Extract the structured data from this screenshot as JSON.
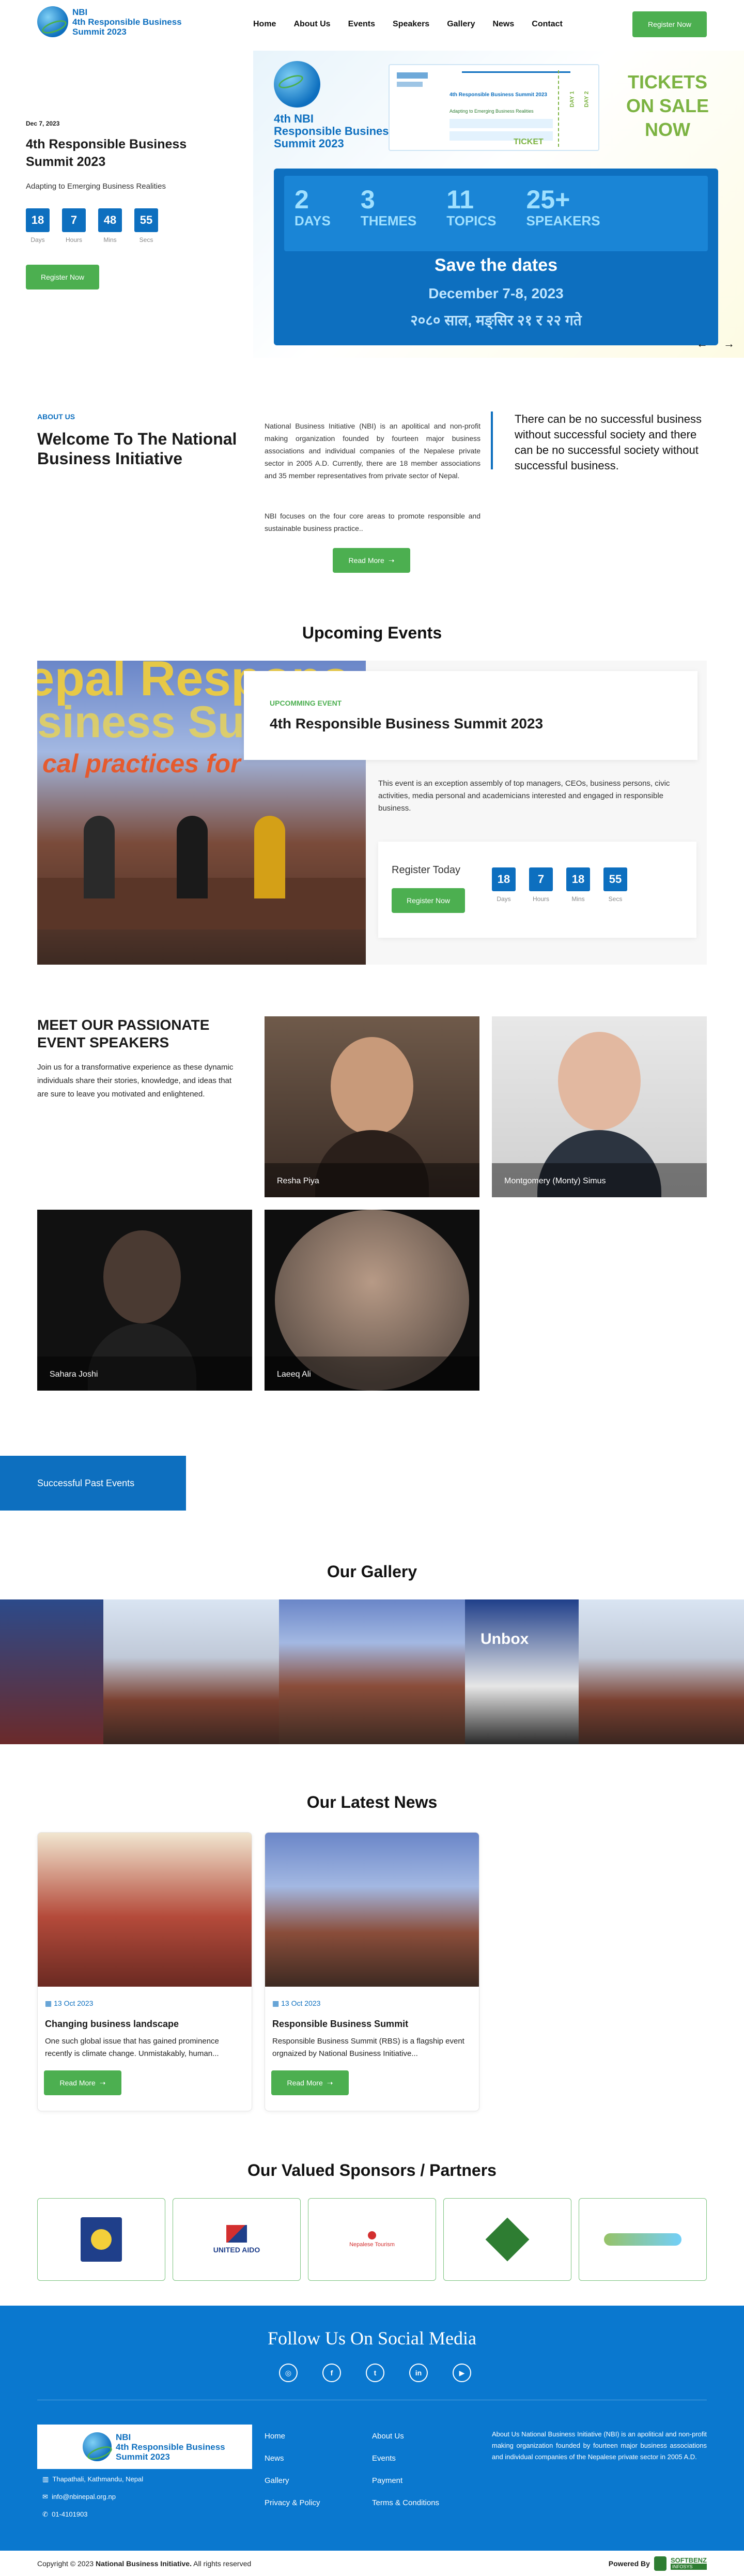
{
  "header": {
    "logo_line1": "NBI",
    "logo_line2": "4th Responsible Business",
    "logo_line3": "Summit 2023",
    "nav": [
      "Home",
      "About Us",
      "Events",
      "Speakers",
      "Gallery",
      "News",
      "Contact"
    ],
    "register_label": "Register Now"
  },
  "hero": {
    "date": "Dec 7, 2023",
    "title": "4th Responsible Business Summit 2023",
    "subtitle": "Adapting to Emerging Business Realities",
    "countdown": [
      {
        "value": "18",
        "label": "Days"
      },
      {
        "value": "7",
        "label": "Hours"
      },
      {
        "value": "48",
        "label": "Mins"
      },
      {
        "value": "55",
        "label": "Secs"
      }
    ],
    "register_label": "Register Now",
    "banner": {
      "logo_line1": "4th NBI",
      "logo_line2": "Responsible Business",
      "logo_line3": "Summit 2023",
      "ticket_title": "4th Responsible Business Summit 2023",
      "ticket_sub": "Adapting to Emerging Business Realities",
      "ticket_word": "TICKET",
      "day1": "DAY 1",
      "day2": "DAY 2",
      "tickets_line1": "TICKETS",
      "tickets_line2": "ON SALE",
      "tickets_line3": "NOW",
      "stats": [
        {
          "num": "2",
          "label": "DAYS"
        },
        {
          "num": "3",
          "label": "THEMES"
        },
        {
          "num": "11",
          "label": "TOPICS"
        },
        {
          "num": "25+",
          "label": "SPEAKERS"
        }
      ],
      "save": "Save the dates",
      "dates": "December 7-8, 2023",
      "dates_np": "२०८० साल, मङ्सिर २१ र २२ गते"
    },
    "prev": "←",
    "next": "→"
  },
  "about": {
    "eyebrow": "ABOUT US",
    "title": "Welcome To The National Business Initiative",
    "p1": "National Business Initiative (NBI) is an apolitical and non-profit making organization founded by fourteen major business associations and individual companies of the Nepalese private sector in 2005 A.D. Currently, there are 18 member associations and 35 member representatives from private sector of Nepal.",
    "p2": "NBI focuses on the four core areas to promote responsible and sustainable business practice..",
    "read_more": "Read More",
    "quote": "There can be no successful business without successful society and there can be no successful society without successful business."
  },
  "upcoming": {
    "section_title": "Upcoming Events",
    "eyebrow": "UPCOMMING EVENT",
    "title": "4th Responsible Business Summit 2023",
    "desc": "This event is an exception assembly of top managers, CEOs, business persons, civic activities, media personal and academicians interested and engaged in responsible business.",
    "register_today": "Register Today",
    "register_label": "Register Now",
    "countdown": [
      {
        "value": "18",
        "label": "Days"
      },
      {
        "value": "7",
        "label": "Hours"
      },
      {
        "value": "18",
        "label": "Mins"
      },
      {
        "value": "55",
        "label": "Secs"
      }
    ],
    "banner_text1": "epal Respons",
    "banner_text2": "siness Sum",
    "banner_text3": "cal practices for"
  },
  "speakers": {
    "title": "MEET OUR PASSIONATE EVENT SPEAKERS",
    "desc": "Join us for a transformative experience as these dynamic individuals share their stories, knowledge, and ideas that are sure to leave you motivated and enlightened.",
    "list": [
      "Resha Piya",
      "Montgomery (Monty) Simus",
      "Sahara Joshi",
      "Laeeq Ali"
    ]
  },
  "past_events": {
    "label": "Successful Past Events"
  },
  "gallery": {
    "title": "Our Gallery",
    "slide_text": "Unbox"
  },
  "news": {
    "title": "Our Latest News",
    "items": [
      {
        "date": "13 Oct 2023",
        "title": "Changing business landscape",
        "excerpt": "One such global issue that has gained prominence recently is climate change. Unmistakably, human...",
        "read_more": "Read More"
      },
      {
        "date": "13 Oct 2023",
        "title": "Responsible Business Summit",
        "excerpt": "Responsible Business Summit (RBS) is a flagship event orgnaized by National Business Initiative...",
        "read_more": "Read More"
      }
    ]
  },
  "sponsors": {
    "title": "Our Valued Sponsors / Partners",
    "items": [
      "UNITED AIDO",
      "Nepalese Tourism"
    ]
  },
  "footer": {
    "follow": "Follow Us On Social Media",
    "socials": [
      {
        "icon": "instagram-icon",
        "glyph": "◎"
      },
      {
        "icon": "facebook-icon",
        "glyph": "f"
      },
      {
        "icon": "twitter-icon",
        "glyph": "t"
      },
      {
        "icon": "linkedin-icon",
        "glyph": "in"
      },
      {
        "icon": "youtube-icon",
        "glyph": "▶"
      }
    ],
    "address": "Thapathali, Kathmandu, Nepal",
    "email": "info@nbinepal.org.np",
    "phone": "01-4101903",
    "links_col1": [
      "Home",
      "News",
      "Gallery",
      "Privacy & Policy"
    ],
    "links_col2": [
      "About Us",
      "Events",
      "Payment",
      "Terms & Conditions"
    ],
    "about_text": "About Us National Business Initiative (NBI) is an apolitical and non-profit making organization founded by fourteen major business associations and individual companies of the Nepalese private sector in 2005 A.D.",
    "copyright_pre": "Copyright © 2023",
    "copyright_org": "National Business Initiative.",
    "copyright_post": "All rights reserved",
    "powered": "Powered By",
    "powered_brand": "SOFTBENZ",
    "powered_sub": "INFOSYS"
  },
  "colors": {
    "primary": "#0d6fbf",
    "accent": "#4caf50"
  }
}
